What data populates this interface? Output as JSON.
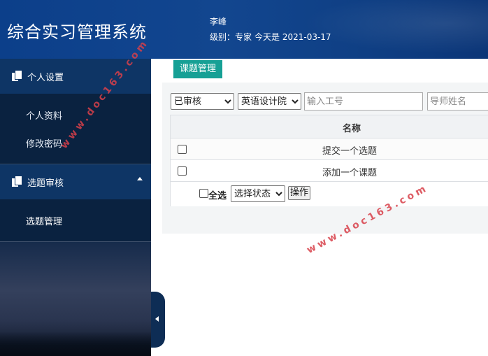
{
  "header": {
    "app_title": "综合实习管理系统",
    "user_name": "李峰",
    "level": "级别：专家",
    "today": "今天是 2021-03-17"
  },
  "sidebar": {
    "sections": [
      {
        "label": "个人设置",
        "icon": "copy-icon",
        "items": [
          "个人资料",
          "修改密码"
        ]
      },
      {
        "label": "选题审核",
        "icon": "copy-icon",
        "items": [
          "选题管理"
        ]
      }
    ]
  },
  "main": {
    "tab_label": "课题管理",
    "filters": {
      "status_selected": "已审核",
      "college_selected": "英语设计院",
      "id_placeholder": "输入工号",
      "name_placeholder": "导师姓名"
    },
    "table": {
      "column_header": "名称",
      "rows": [
        "提交一个选题",
        "添加一个课题"
      ]
    },
    "footer": {
      "select_all": "全选",
      "state_selected": "选择状态",
      "action_button": "操作"
    }
  },
  "watermark": "www.doc163.com",
  "colors": {
    "header_bg": "#12468f",
    "sidebar_bg": "#0b2444",
    "accent": "#16a095",
    "watermark": "#d8404a"
  }
}
